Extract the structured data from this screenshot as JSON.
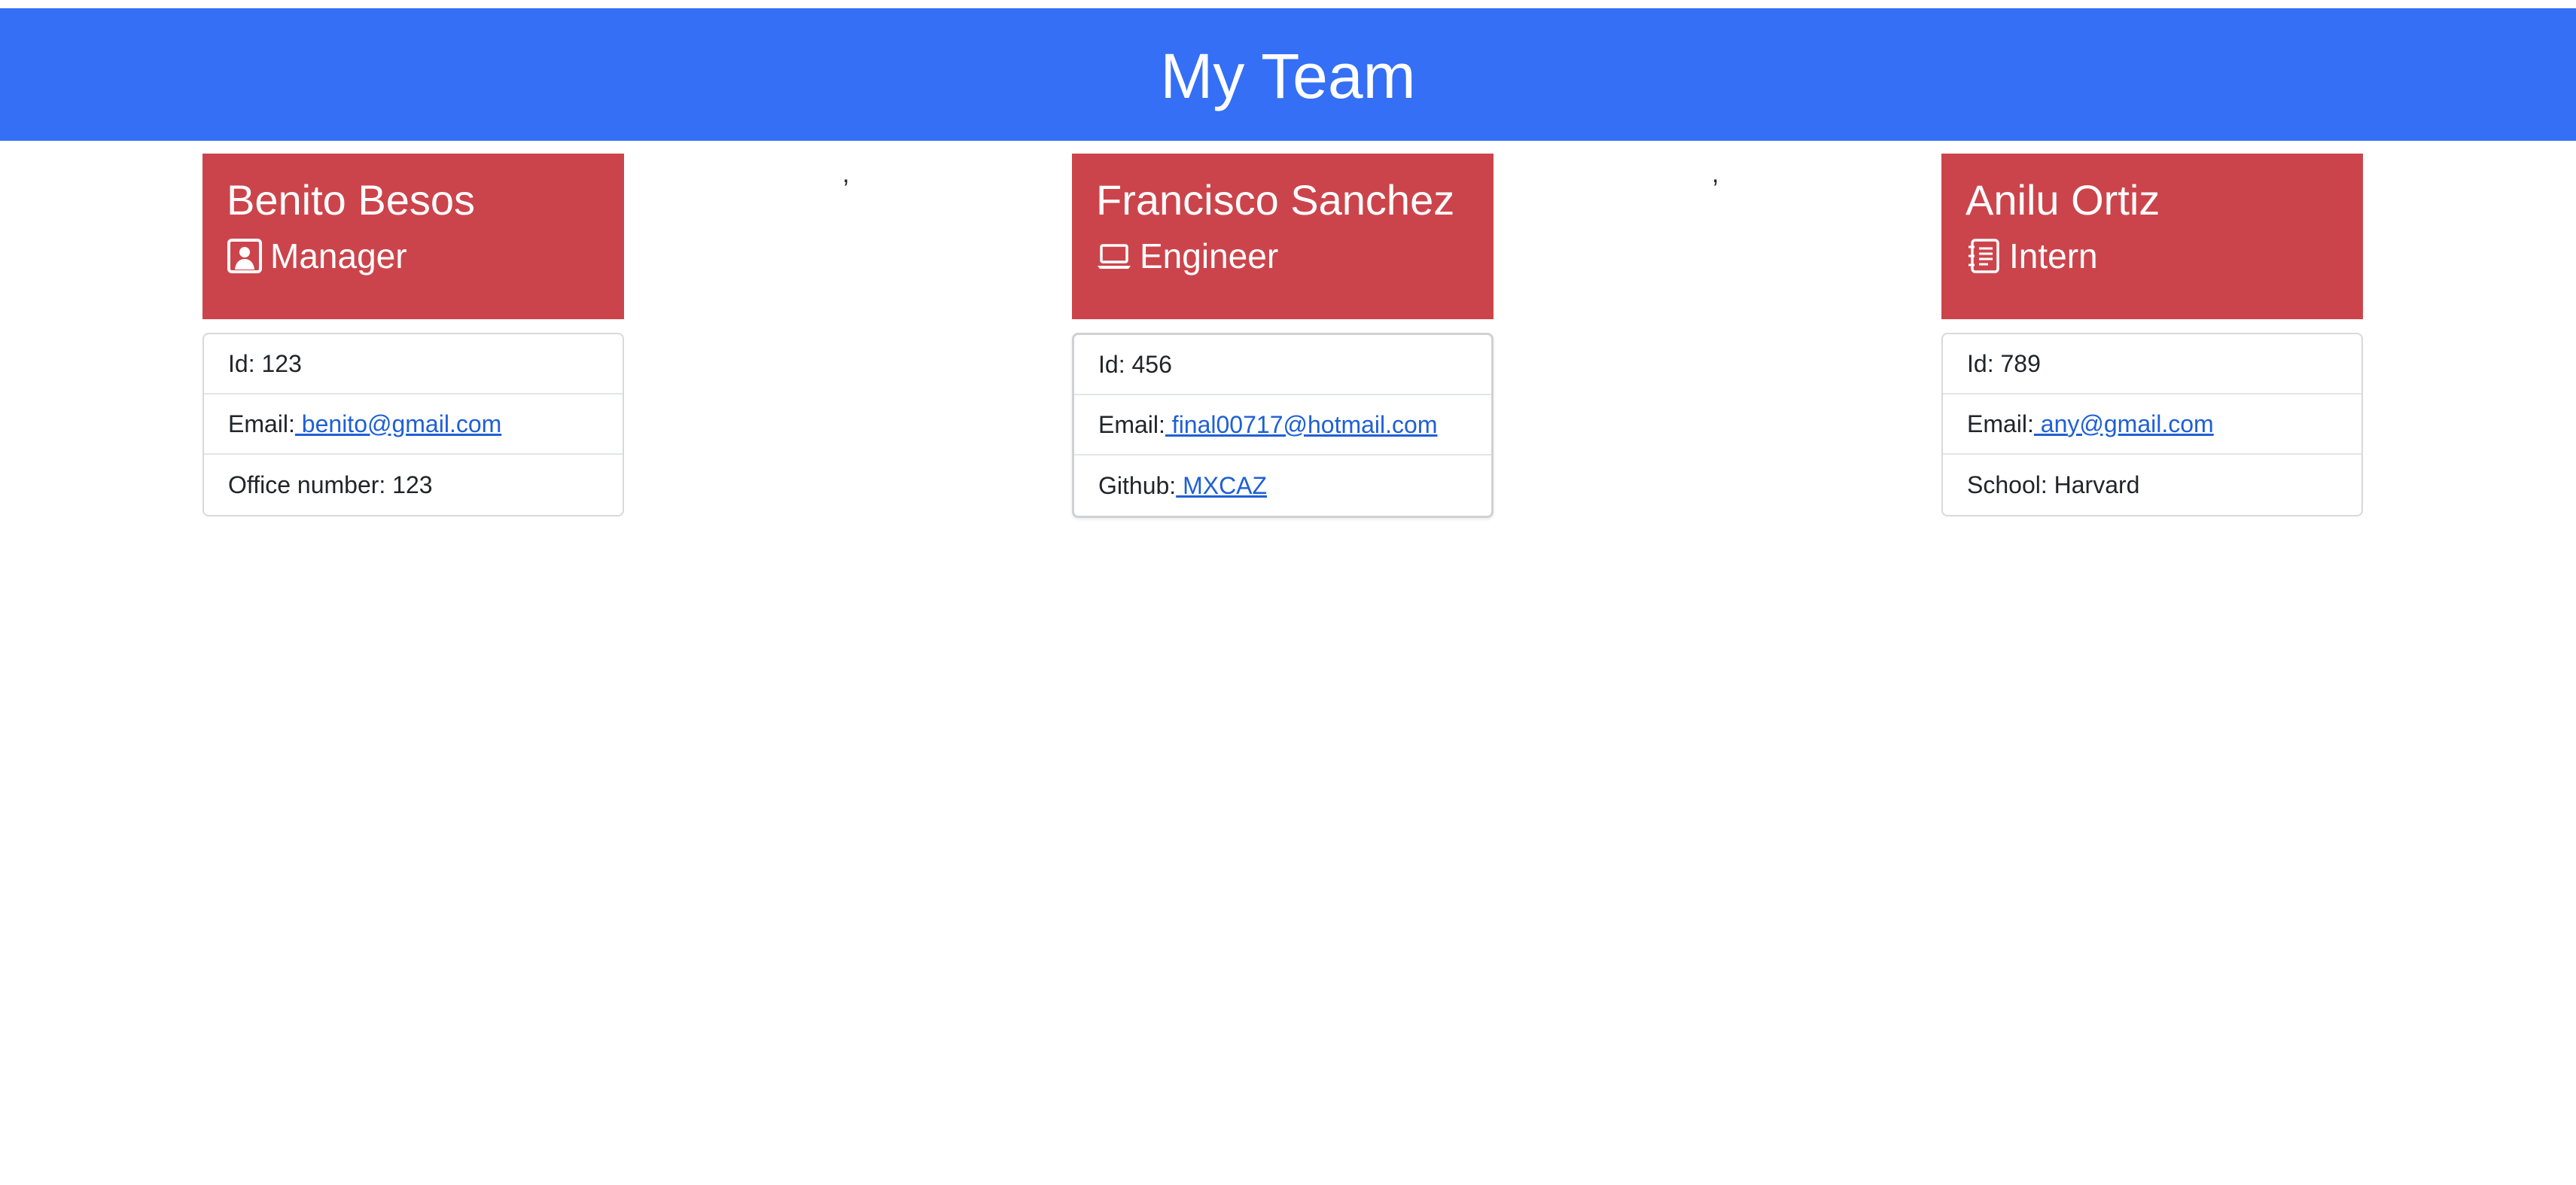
{
  "header": {
    "title": "My Team"
  },
  "separators": [
    ",",
    ","
  ],
  "team": [
    {
      "name": "Benito Besos",
      "role": "Manager",
      "role_icon": "person-badge-icon",
      "id_label": "Id: 123",
      "email_label": "Email:",
      "email_link": " benito@gmail.com",
      "extra_label": "Office number: 123"
    },
    {
      "name": "Francisco Sanchez",
      "role": "Engineer",
      "role_icon": "laptop-icon",
      "id_label": "Id: 456",
      "email_label": "Email:",
      "email_link": " final00717@hotmail.com",
      "extra_label": "Github:",
      "extra_link": " MXCAZ"
    },
    {
      "name": "Anilu Ortiz",
      "role": "Intern",
      "role_icon": "notebook-icon",
      "id_label": "Id: 789",
      "email_label": "Email:",
      "email_link": " any@gmail.com",
      "extra_label": "School: Harvard"
    }
  ],
  "colors": {
    "header_bg": "#346ff5",
    "card_head_bg": "#cc444b",
    "link": "#1f5fd6"
  }
}
